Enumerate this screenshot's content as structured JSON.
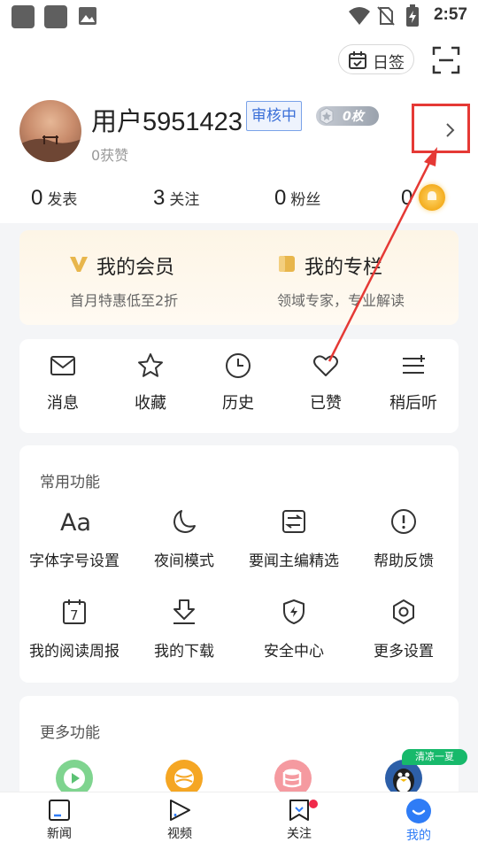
{
  "status_bar": {
    "time": "2:57",
    "icons": [
      "notification-square-icon",
      "notification-square-icon",
      "image-icon",
      "wifi-icon",
      "no-sim-icon",
      "battery-charging-icon"
    ]
  },
  "header": {
    "checkin_label": "日签",
    "checkin_icon": "calendar-check-icon",
    "scan_icon": "scan-icon"
  },
  "profile": {
    "username": "用户5951423",
    "review_badge": "审核中",
    "medal_label": "0枚",
    "likes": "0获赞"
  },
  "stats": [
    {
      "num": "0",
      "label": "发表"
    },
    {
      "num": "3",
      "label": "关注"
    },
    {
      "num": "0",
      "label": "粉丝"
    },
    {
      "num": "0",
      "label": ""
    }
  ],
  "vip": {
    "member_title": "我的会员",
    "member_sub": "首月特惠低至2折",
    "column_title": "我的专栏",
    "column_sub": "领域专家，专业解读"
  },
  "shortcuts": [
    {
      "label": "消息",
      "icon": "mail-icon"
    },
    {
      "label": "收藏",
      "icon": "star-icon"
    },
    {
      "label": "历史",
      "icon": "clock-icon"
    },
    {
      "label": "已赞",
      "icon": "heart-icon"
    },
    {
      "label": "稍后听",
      "icon": "listen-later-icon"
    }
  ],
  "common": {
    "title": "常用功能",
    "items": [
      {
        "label": "字体字号设置",
        "icon": "font-size-icon",
        "glyph": "Aa"
      },
      {
        "label": "夜间模式",
        "icon": "moon-icon"
      },
      {
        "label": "要闻主编精选",
        "icon": "editor-pick-icon"
      },
      {
        "label": "帮助反馈",
        "icon": "help-icon"
      },
      {
        "label": "我的阅读周报",
        "icon": "weekly-report-icon",
        "glyph": "7"
      },
      {
        "label": "我的下载",
        "icon": "download-icon"
      },
      {
        "label": "安全中心",
        "icon": "shield-icon"
      },
      {
        "label": "更多设置",
        "icon": "settings-hex-icon"
      }
    ]
  },
  "more": {
    "title": "更多功能",
    "summer_tag": "清凉一夏",
    "icons": [
      "video-play-icon",
      "sports-ball-icon",
      "database-icon",
      "penguin-avatar-icon"
    ]
  },
  "tabs": [
    {
      "label": "新闻",
      "icon": "news-icon"
    },
    {
      "label": "视频",
      "icon": "video-tab-icon"
    },
    {
      "label": "关注",
      "icon": "follow-tab-icon"
    },
    {
      "label": "我的",
      "icon": "me-tab-icon"
    }
  ],
  "colors": {
    "accent_blue": "#2f7cf6",
    "annotation_red": "#e53935",
    "badge_blue": "#3a6fd8",
    "vip_gold": "#e8b64c",
    "notify_red": "#f0294a"
  }
}
